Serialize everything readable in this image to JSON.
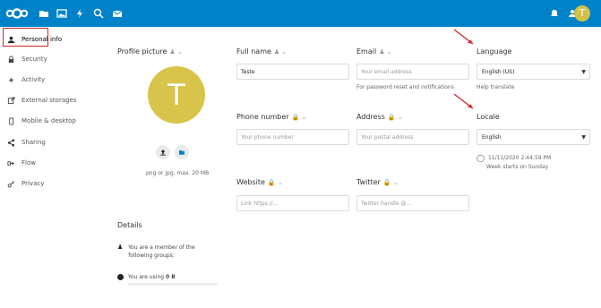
{
  "sidebar": {
    "items": [
      {
        "label": "Personal info",
        "icon": "user-icon"
      },
      {
        "label": "Security",
        "icon": "lock-icon"
      },
      {
        "label": "Activity",
        "icon": "activity-icon"
      },
      {
        "label": "External storages",
        "icon": "external-storage-icon"
      },
      {
        "label": "Mobile & desktop",
        "icon": "mobile-icon"
      },
      {
        "label": "Sharing",
        "icon": "share-icon"
      },
      {
        "label": "Flow",
        "icon": "flow-icon"
      },
      {
        "label": "Privacy",
        "icon": "key-icon"
      }
    ]
  },
  "header": {
    "avatar_initial": "T"
  },
  "profile": {
    "title": "Profile picture",
    "avatar_initial": "T",
    "hint": "png or jpg, max. 20 MB"
  },
  "fullname": {
    "label": "Full name",
    "value": "Teste"
  },
  "email": {
    "label": "Email",
    "placeholder": "Your email address",
    "hint": "For password reset and notifications"
  },
  "language": {
    "label": "Language",
    "value": "English (US)",
    "hint": "Help translate"
  },
  "phone": {
    "label": "Phone number",
    "placeholder": "Your phone number"
  },
  "address": {
    "label": "Address",
    "placeholder": "Your postal address"
  },
  "locale": {
    "label": "Locale",
    "value": "English",
    "datetime": "11/11/2020 2:44:59 PM",
    "week": "Week starts on Sunday"
  },
  "website": {
    "label": "Website",
    "placeholder": "Link https://..."
  },
  "twitter": {
    "label": "Twitter",
    "placeholder": "Twitter handle @..."
  },
  "details": {
    "title": "Details",
    "groups": "You are a member of the following groups:",
    "usage_prefix": "You are using ",
    "usage_value": "0 B",
    "usage_fraction": 0
  },
  "colors": {
    "header": "#0082c9",
    "avatar": "#d8c44b",
    "highlight": "#d9232c"
  }
}
